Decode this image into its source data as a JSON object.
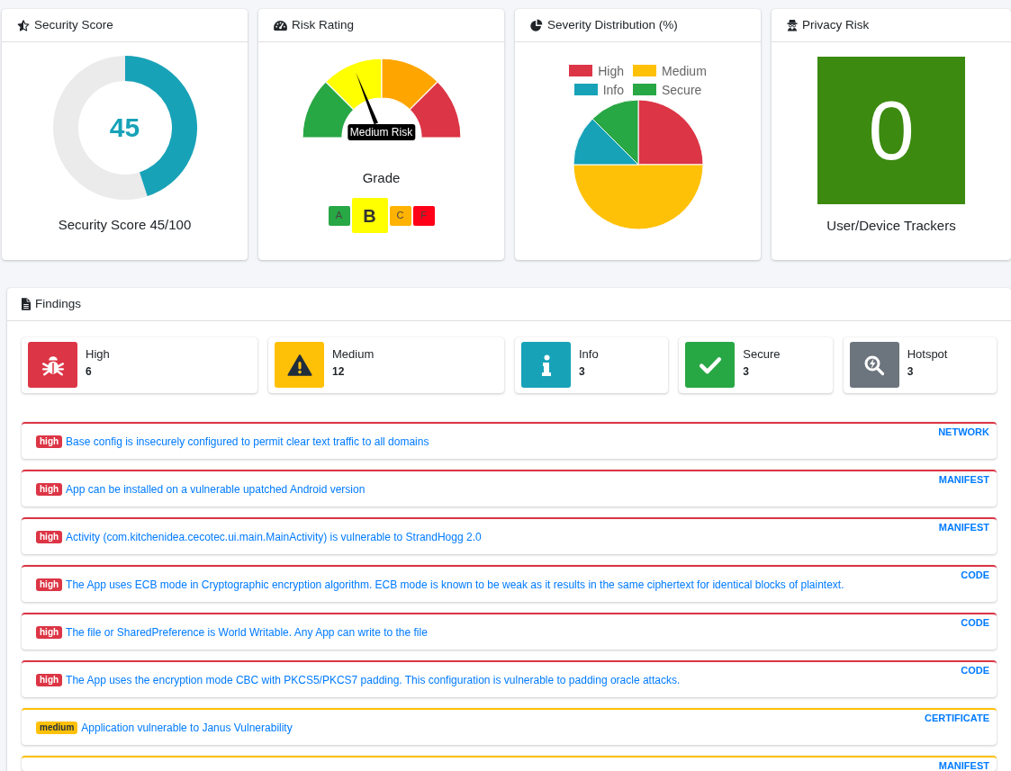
{
  "cards": [
    {
      "kind": "score",
      "title": "Security Score",
      "value": "45",
      "level": 0.45,
      "caption": "Security Score 45/100"
    },
    {
      "kind": "risk",
      "title": "Risk Rating",
      "gauge_label": "Medium Risk",
      "level": 0.38,
      "grade_title": "Grade",
      "grades": [
        {
          "letter": "A",
          "color": "#28a745",
          "selected": false
        },
        {
          "letter": "B",
          "color": "#ffff00",
          "selected": true
        },
        {
          "letter": "C",
          "color": "#ffb300",
          "selected": false
        },
        {
          "letter": "F",
          "color": "#ff0018",
          "selected": false
        }
      ]
    },
    {
      "kind": "distribution",
      "title": "Severity Distribution (%)",
      "legend": [
        {
          "label": "High",
          "color": "#dc3545"
        },
        {
          "label": "Medium",
          "color": "#ffc107"
        },
        {
          "label": "Info",
          "color": "#17a2b8"
        },
        {
          "label": "Secure",
          "color": "#28a745"
        }
      ]
    },
    {
      "kind": "privacy",
      "title": "Privacy Risk",
      "value": "0",
      "caption": "User/Device Trackers"
    }
  ],
  "findings": {
    "title": "Findings",
    "stats": [
      {
        "kind": "high",
        "label": "High",
        "count": "6",
        "color": "#dc3545"
      },
      {
        "kind": "medium",
        "label": "Medium",
        "count": "12",
        "color": "#ffc107"
      },
      {
        "kind": "info",
        "label": "Info",
        "count": "3",
        "color": "#17a2b8"
      },
      {
        "kind": "secure",
        "label": "Secure",
        "count": "3",
        "color": "#28a745"
      },
      {
        "kind": "hotspot",
        "label": "Hotspot",
        "count": "3",
        "color": "#6c757d"
      }
    ],
    "items": [
      {
        "badge": "high",
        "title": "Base config is insecurely configured to permit clear text traffic to all domains",
        "category": "NETWORK",
        "color": "#dc3545"
      },
      {
        "badge": "high",
        "title": "App can be installed on a vulnerable upatched Android version",
        "category": "MANIFEST",
        "color": "#dc3545"
      },
      {
        "badge": "high",
        "title": "Activity (com.kitchenidea.cecotec.ui.main.MainActivity) is vulnerable to StrandHogg 2.0",
        "category": "MANIFEST",
        "color": "#dc3545"
      },
      {
        "badge": "high",
        "title": "The App uses ECB mode in Cryptographic encryption algorithm. ECB mode is known to be weak as it results in the same ciphertext for identical blocks of plaintext.",
        "category": "CODE",
        "color": "#dc3545"
      },
      {
        "badge": "high",
        "title": "The file or SharedPreference is World Writable. Any App can write to the file",
        "category": "CODE",
        "color": "#dc3545"
      },
      {
        "badge": "high",
        "title": "The App uses the encryption mode CBC with PKCS5/PKCS7 padding. This configuration is vulnerable to padding oracle attacks.",
        "category": "CODE",
        "color": "#dc3545"
      },
      {
        "badge": "medium",
        "title": "Application vulnerable to Janus Vulnerability",
        "category": "CERTIFICATE",
        "color": "#ffc107"
      },
      {
        "category": "MANIFEST",
        "color": "#ffc107"
      }
    ]
  }
}
